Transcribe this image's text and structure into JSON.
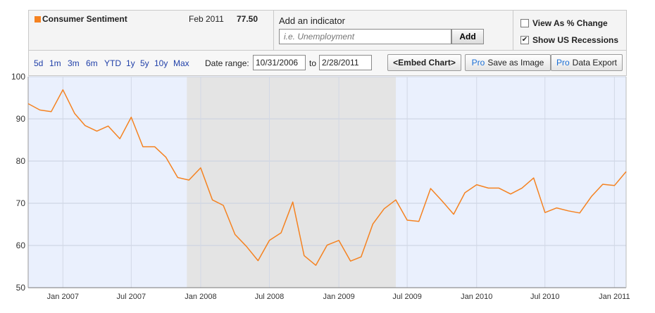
{
  "header": {
    "series_name": "Consumer Sentiment",
    "series_color": "#f58220",
    "latest_date": "Feb 2011",
    "latest_value": "77.50",
    "add_indicator_label": "Add an indicator",
    "indicator_placeholder": "i.e. Unemployment",
    "add_button": "Add",
    "view_pct_label": "View As % Change",
    "view_pct_checked": false,
    "recessions_label": "Show US Recessions",
    "recessions_checked": true
  },
  "toolbar": {
    "ranges": [
      "5d",
      "1m",
      "3m",
      "6m",
      "YTD",
      "1y",
      "5y",
      "10y",
      "Max"
    ],
    "date_range_label": "Date range:",
    "start_date": "10/31/2006",
    "to_label": "to",
    "end_date": "2/28/2011",
    "embed_button": "<Embed Chart>",
    "pro_label": "Pro",
    "save_image_label": "Save as Image",
    "data_export_label": "Data Export"
  },
  "chart_data": {
    "type": "line",
    "ylim": [
      50,
      100
    ],
    "yticks": [
      50,
      60,
      70,
      80,
      90,
      100
    ],
    "xlabels": [
      "Jan 2007",
      "Jul 2007",
      "Jan 2008",
      "Jul 2008",
      "Jan 2009",
      "Jul 2009",
      "Jan 2010",
      "Jul 2010",
      "Jan 2011"
    ],
    "grid": true,
    "recession": {
      "start": "2007-12",
      "end": "2009-06",
      "color": "#e4e4e4"
    },
    "background_color": "#eaf0fd",
    "line_color": "#f58220",
    "series": [
      {
        "x": [
          "2006-10",
          "2006-11",
          "2006-12",
          "2007-01",
          "2007-02",
          "2007-03",
          "2007-04",
          "2007-05",
          "2007-06",
          "2007-07",
          "2007-08",
          "2007-09",
          "2007-10",
          "2007-11",
          "2007-12",
          "2008-01",
          "2008-02",
          "2008-03",
          "2008-04",
          "2008-05",
          "2008-06",
          "2008-07",
          "2008-08",
          "2008-09",
          "2008-10",
          "2008-11",
          "2008-12",
          "2009-01",
          "2009-02",
          "2009-03",
          "2009-04",
          "2009-05",
          "2009-06",
          "2009-07",
          "2009-08",
          "2009-09",
          "2009-10",
          "2009-11",
          "2009-12",
          "2010-01",
          "2010-02",
          "2010-03",
          "2010-04",
          "2010-05",
          "2010-06",
          "2010-07",
          "2010-08",
          "2010-09",
          "2010-10",
          "2010-11",
          "2010-12",
          "2011-01",
          "2011-02"
        ],
        "values": [
          93.6,
          92.1,
          91.7,
          96.9,
          91.3,
          88.4,
          87.1,
          88.3,
          85.3,
          90.4,
          83.4,
          83.4,
          80.9,
          76.1,
          75.5,
          78.4,
          70.8,
          69.5,
          62.6,
          59.8,
          56.4,
          61.2,
          63.0,
          70.3,
          57.6,
          55.3,
          60.1,
          61.2,
          56.3,
          57.3,
          65.1,
          68.7,
          70.8,
          66.0,
          65.7,
          73.5,
          70.6,
          67.4,
          72.5,
          74.4,
          73.6,
          73.6,
          72.2,
          73.6,
          76.0,
          67.8,
          68.9,
          68.2,
          67.7,
          71.6,
          74.5,
          74.2,
          77.5
        ]
      }
    ]
  }
}
